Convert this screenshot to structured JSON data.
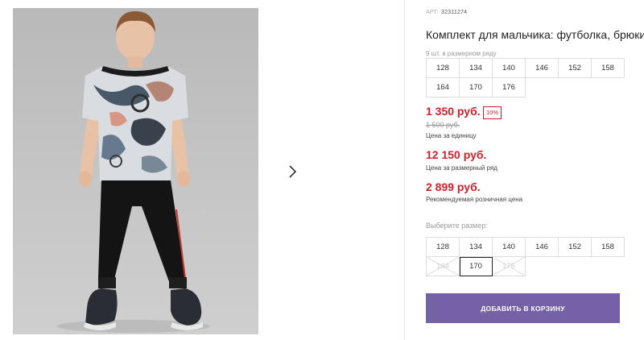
{
  "gallery": {
    "next_arrow_icon": "chevron-right-icon"
  },
  "product": {
    "article_label": "АРТ:",
    "article_number": "32311274",
    "title": "Комплект для мальчика: футболка, брюки",
    "size_row_note": "9 шт. в размерном ряду",
    "size_row": [
      "128",
      "134",
      "140",
      "146",
      "152",
      "158",
      "164",
      "170",
      "176"
    ],
    "price": "1 350 руб.",
    "discount": "10%",
    "old_price": "1 500 руб.",
    "price_unit_label": "Цена за единицу",
    "price_range": "12 150 руб.",
    "price_range_label": "Цена за размерный ряд",
    "price_rrp": "2 899 руб.",
    "price_rrp_label": "Рекомендуемая розничная цена"
  },
  "size_picker": {
    "label": "Выберите размер:",
    "sizes": [
      {
        "value": "128",
        "available": true,
        "selected": false
      },
      {
        "value": "134",
        "available": true,
        "selected": false
      },
      {
        "value": "140",
        "available": true,
        "selected": false
      },
      {
        "value": "146",
        "available": true,
        "selected": false
      },
      {
        "value": "152",
        "available": true,
        "selected": false
      },
      {
        "value": "158",
        "available": true,
        "selected": false
      },
      {
        "value": "164",
        "available": false,
        "selected": false
      },
      {
        "value": "170",
        "available": true,
        "selected": true
      },
      {
        "value": "176",
        "available": false,
        "selected": false
      }
    ]
  },
  "cart": {
    "add_label": "ДОБАВИТЬ В КОРЗИНУ"
  },
  "colors": {
    "price_red": "#d0202a",
    "button_purple": "#7561a6"
  }
}
